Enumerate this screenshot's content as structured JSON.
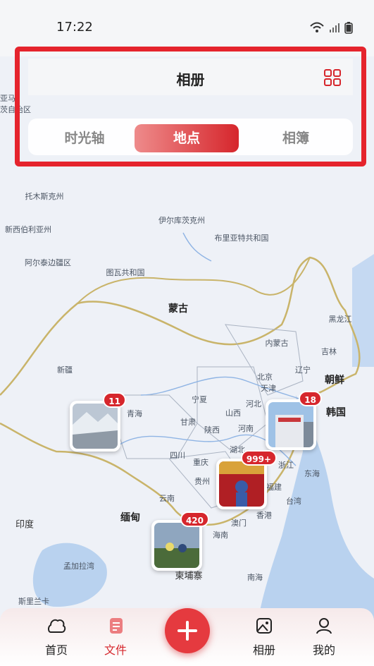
{
  "status": {
    "time": "17:22",
    "wifi_icon": "wifi-icon",
    "signal_icon": "signal-icon",
    "battery_icon": "battery-icon"
  },
  "header": {
    "title": "相册",
    "grid_icon": "grid-icon"
  },
  "tabs": [
    {
      "label": "时光轴",
      "active": false
    },
    {
      "label": "地点",
      "active": true
    },
    {
      "label": "相簿",
      "active": false
    }
  ],
  "map_labels": {
    "tuomusike": "托木斯克州",
    "xinxibo": "新西伯利亚州",
    "aertai": "阿尔泰边疆区",
    "yierku": "伊尔库茨克州",
    "buliat": "布里亚特共和国",
    "tuwa": "图瓦共和国",
    "mongolia": "蒙古",
    "heilongjiang": "黑龙江",
    "jilin": "吉林",
    "liaoning": "辽宁",
    "neimenggu": "内蒙古",
    "xinjiang": "新疆",
    "qinghai": "青海",
    "gansu": "甘肃",
    "ningxia": "宁夏",
    "shanxi": "山西",
    "hebei": "河北",
    "beijing": "北京",
    "tianjin": "天津",
    "shaanxi": "陕西",
    "henan": "河南",
    "sichuan": "四川",
    "chongqing": "重庆",
    "hubei": "湖北",
    "guizhou": "贵州",
    "yunnan": "云南",
    "zhejiang": "浙江",
    "fujian": "福建",
    "xianggang": "香港",
    "aomen": "澳门",
    "hainan": "海南",
    "taiwan": "台湾",
    "chaoxian": "朝鲜",
    "hanguo": "韩国",
    "donghai": "东海",
    "nanhai": "南海",
    "yindu": "印度",
    "miandian": "缅甸",
    "mengjiala": "孟加拉湾",
    "jianpuzhai": "柬埔寨",
    "top_left": "亚马\n茨自治区",
    "top_left2": "斯里兰卡"
  },
  "pins": [
    {
      "name": "pin-xizang",
      "count": "11"
    },
    {
      "name": "pin-shanghai",
      "count": "18"
    },
    {
      "name": "pin-guangdong",
      "count": "999+"
    },
    {
      "name": "pin-vietnam",
      "count": "420"
    }
  ],
  "bottom_nav": [
    {
      "label": "首页",
      "icon": "home-icon"
    },
    {
      "label": "文件",
      "icon": "file-icon",
      "active": true
    },
    {
      "label": "相册",
      "icon": "album-icon"
    },
    {
      "label": "我的",
      "icon": "profile-icon"
    }
  ],
  "fab_icon": "plus-icon",
  "colors": {
    "accent": "#d6262c",
    "highlight_box": "#e5242d"
  }
}
